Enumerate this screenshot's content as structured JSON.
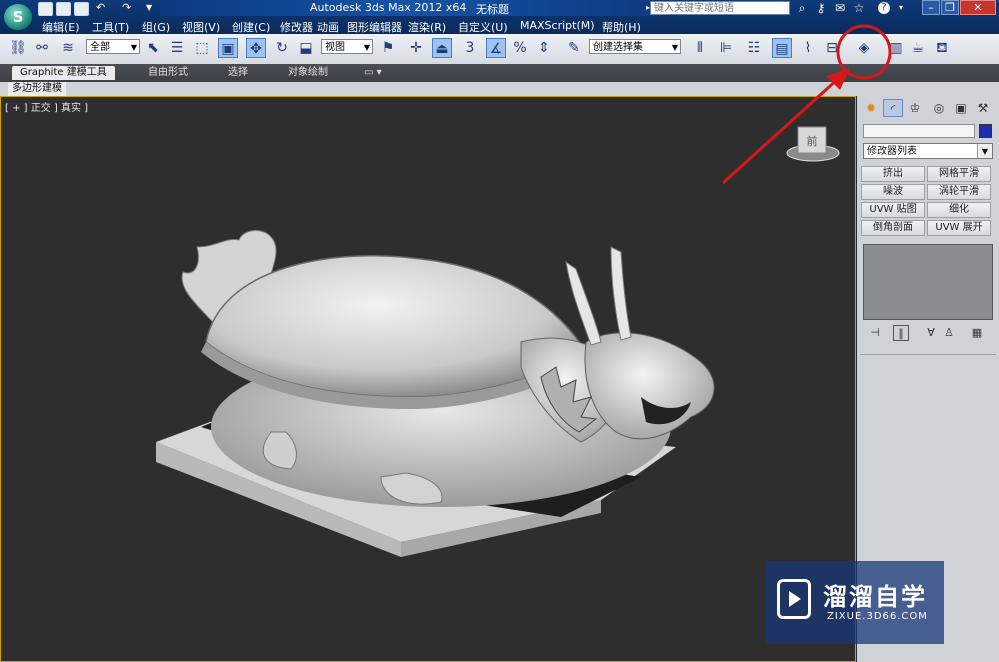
{
  "titlebar": {
    "window_title": "Autodesk 3ds Max  2012 x64",
    "doc_title": "无标题",
    "search_placeholder": "键入关键字或短语",
    "app_logo": "S"
  },
  "menu": [
    "编辑(E)",
    "工具(T)",
    "组(G)",
    "视图(V)",
    "创建(C)",
    "修改器",
    "动画",
    "图形编辑器",
    "渲染(R)",
    "自定义(U)",
    "MAXScript(M)",
    "帮助(H)"
  ],
  "toolbar": {
    "selection_filter": "全部",
    "reference_coord": "视图",
    "snap_label": "3",
    "named_selection": "创建选择集"
  },
  "ribbon": {
    "tabs": [
      "Graphite 建模工具",
      "自由形式",
      "选择",
      "对象绘制"
    ],
    "sub_label": "多边形建模"
  },
  "viewport": {
    "label": "[ + ] 正交 ] 真实 ]",
    "viewcube_label": "前"
  },
  "command_panel": {
    "modifier_list": "修改器列表",
    "buttons": [
      "挤出",
      "网格平滑",
      "噪波",
      "涡轮平滑",
      "UVW 贴图",
      "细化",
      "倒角剖面",
      "UVW 展开"
    ],
    "object_color": "#1c2fb0"
  },
  "annotation": {
    "color": "#d81818"
  },
  "watermark": {
    "name": "溜溜自学",
    "url": "ZIXUE.3D66.COM"
  }
}
